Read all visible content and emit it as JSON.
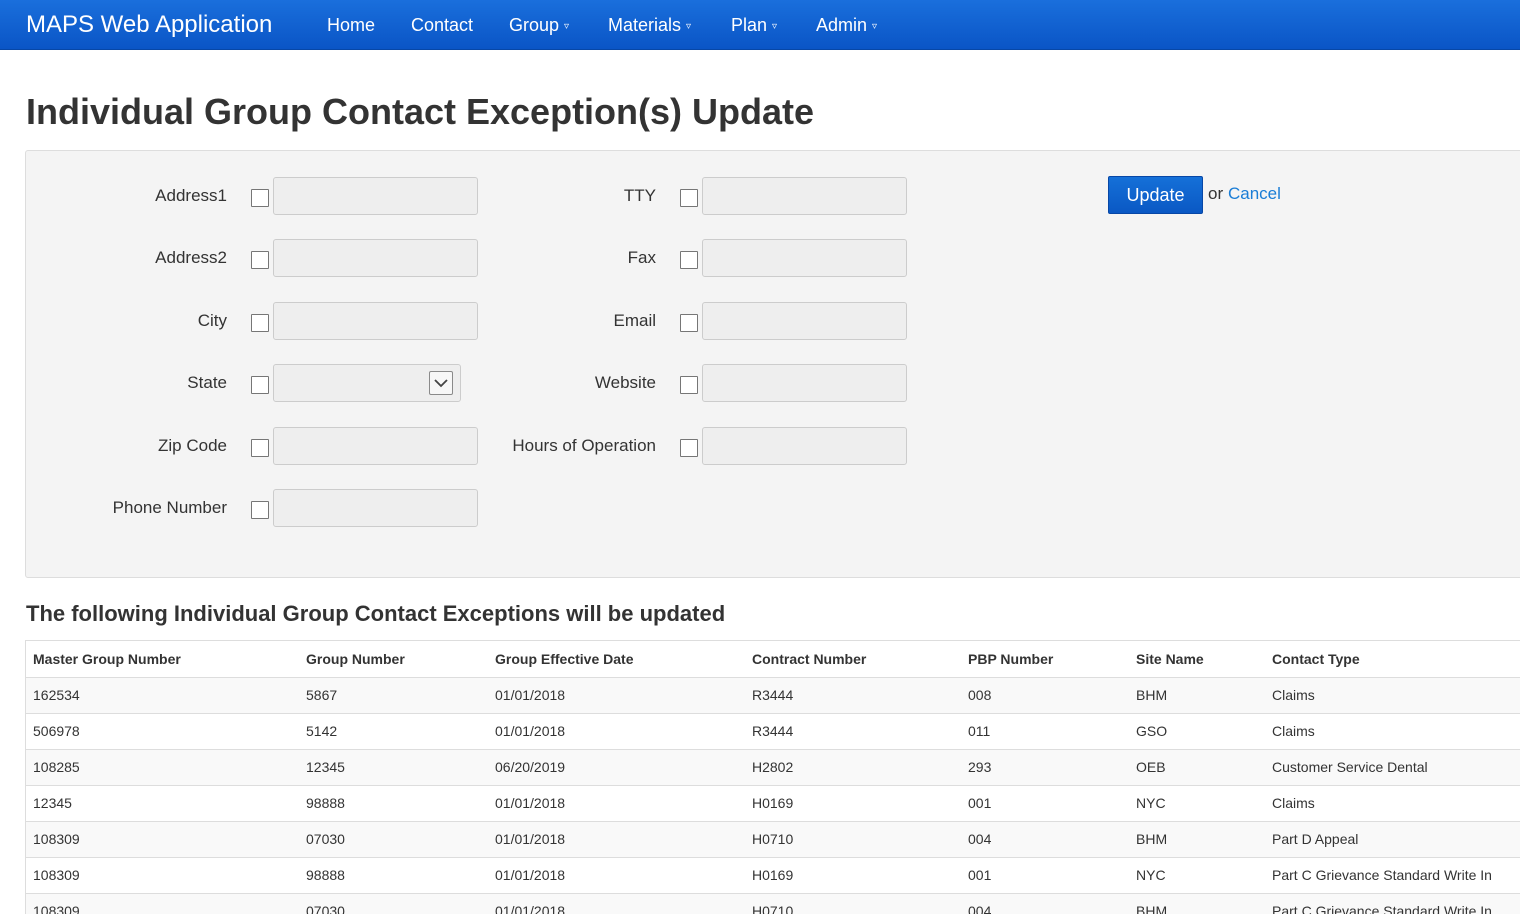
{
  "navbar": {
    "brand": "MAPS Web Application",
    "items": [
      {
        "label": "Home",
        "dropdown": false
      },
      {
        "label": "Contact",
        "dropdown": false
      },
      {
        "label": "Group",
        "dropdown": true
      },
      {
        "label": "Materials",
        "dropdown": true
      },
      {
        "label": "Plan",
        "dropdown": true
      },
      {
        "label": "Admin",
        "dropdown": true
      }
    ],
    "caret_glyph": "▿",
    "bg_color": "#0a55c6"
  },
  "page_title": "Individual Group Contact Exception(s) Update",
  "form": {
    "left_fields": [
      {
        "label": "Address1",
        "value": ""
      },
      {
        "label": "Address2",
        "value": ""
      },
      {
        "label": "City",
        "value": ""
      },
      {
        "label": "State",
        "value": "",
        "type": "select"
      },
      {
        "label": "Zip Code",
        "value": ""
      },
      {
        "label": "Phone Number",
        "value": ""
      }
    ],
    "right_fields": [
      {
        "label": "TTY",
        "value": ""
      },
      {
        "label": "Fax",
        "value": ""
      },
      {
        "label": "Email",
        "value": ""
      },
      {
        "label": "Website",
        "value": ""
      },
      {
        "label": "Hours of Operation",
        "value": ""
      }
    ],
    "update_label": "Update",
    "or_text": "or",
    "cancel_label": "Cancel",
    "select_icon": "chevron-down-icon",
    "accent_color": "#0a58c4",
    "link_color": "#1a7dd6"
  },
  "table": {
    "heading": "The following Individual Group Contact Exceptions will be updated",
    "columns": [
      "Master Group Number",
      "Group Number",
      "Group Effective Date",
      "Contract Number",
      "PBP Number",
      "Site Name",
      "Contact Type"
    ],
    "rows": [
      [
        "162534",
        "5867",
        "01/01/2018",
        "R3444",
        "008",
        "BHM",
        "Claims"
      ],
      [
        "506978",
        "5142",
        "01/01/2018",
        "R3444",
        "011",
        "GSO",
        "Claims"
      ],
      [
        "108285",
        "12345",
        "06/20/2019",
        "H2802",
        "293",
        "OEB",
        "Customer Service Dental"
      ],
      [
        "12345",
        "98888",
        "01/01/2018",
        "H0169",
        "001",
        "NYC",
        "Claims"
      ],
      [
        "108309",
        "07030",
        "01/01/2018",
        "H0710",
        "004",
        "BHM",
        "Part D Appeal"
      ],
      [
        "108309",
        "98888",
        "01/01/2018",
        "H0169",
        "001",
        "NYC",
        "Part C Grievance Standard Write In"
      ],
      [
        "108309",
        "07030",
        "01/01/2018",
        "H0710",
        "004",
        "BHM",
        "Part C Grievance Standard Write In"
      ]
    ]
  }
}
